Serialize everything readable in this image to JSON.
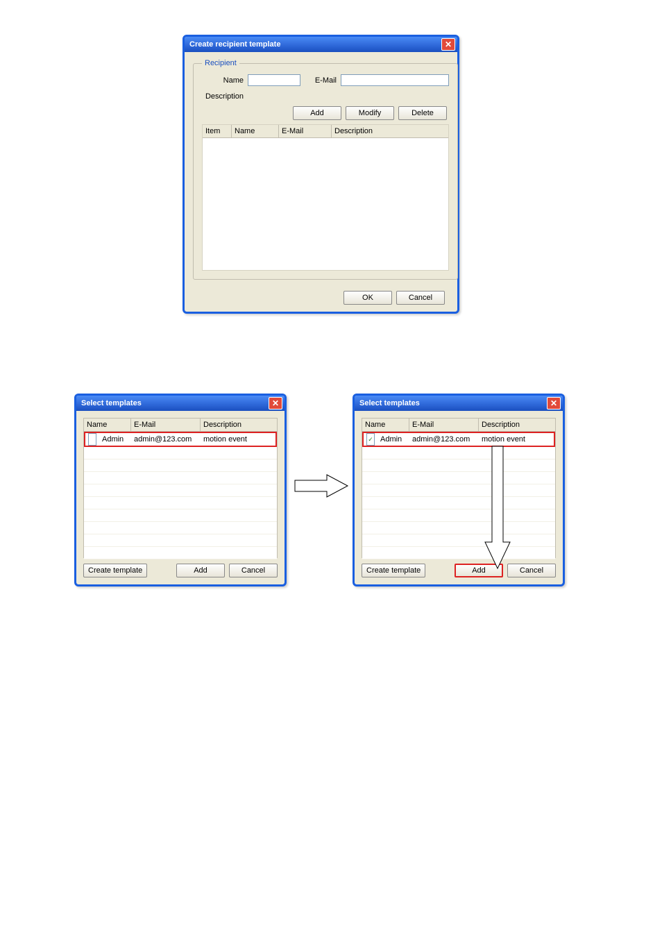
{
  "dialog_create": {
    "title": "Create recipient template",
    "group_legend": "Recipient",
    "labels": {
      "name": "Name",
      "email": "E-Mail",
      "description": "Description"
    },
    "values": {
      "name": "",
      "email": "",
      "description": ""
    },
    "buttons": {
      "add": "Add",
      "modify": "Modify",
      "delete": "Delete"
    },
    "list_headers": {
      "item": "Item",
      "name": "Name",
      "email": "E-Mail",
      "description": "Description"
    },
    "footer": {
      "ok": "OK",
      "cancel": "Cancel"
    }
  },
  "dialog_select_left": {
    "title": "Select templates",
    "headers": {
      "name": "Name",
      "email": "E-Mail",
      "description": "Description"
    },
    "row": {
      "checked": false,
      "name": "Admin",
      "email": "admin@123.com",
      "description": "motion event"
    },
    "buttons": {
      "create": "Create template",
      "add": "Add",
      "cancel": "Cancel"
    }
  },
  "dialog_select_right": {
    "title": "Select templates",
    "headers": {
      "name": "Name",
      "email": "E-Mail",
      "description": "Description"
    },
    "row": {
      "checked": true,
      "name": "Admin",
      "email": "admin@123.com",
      "description": "motion event"
    },
    "buttons": {
      "create": "Create template",
      "add": "Add",
      "cancel": "Cancel"
    }
  },
  "icons": {
    "close": "close-icon"
  }
}
